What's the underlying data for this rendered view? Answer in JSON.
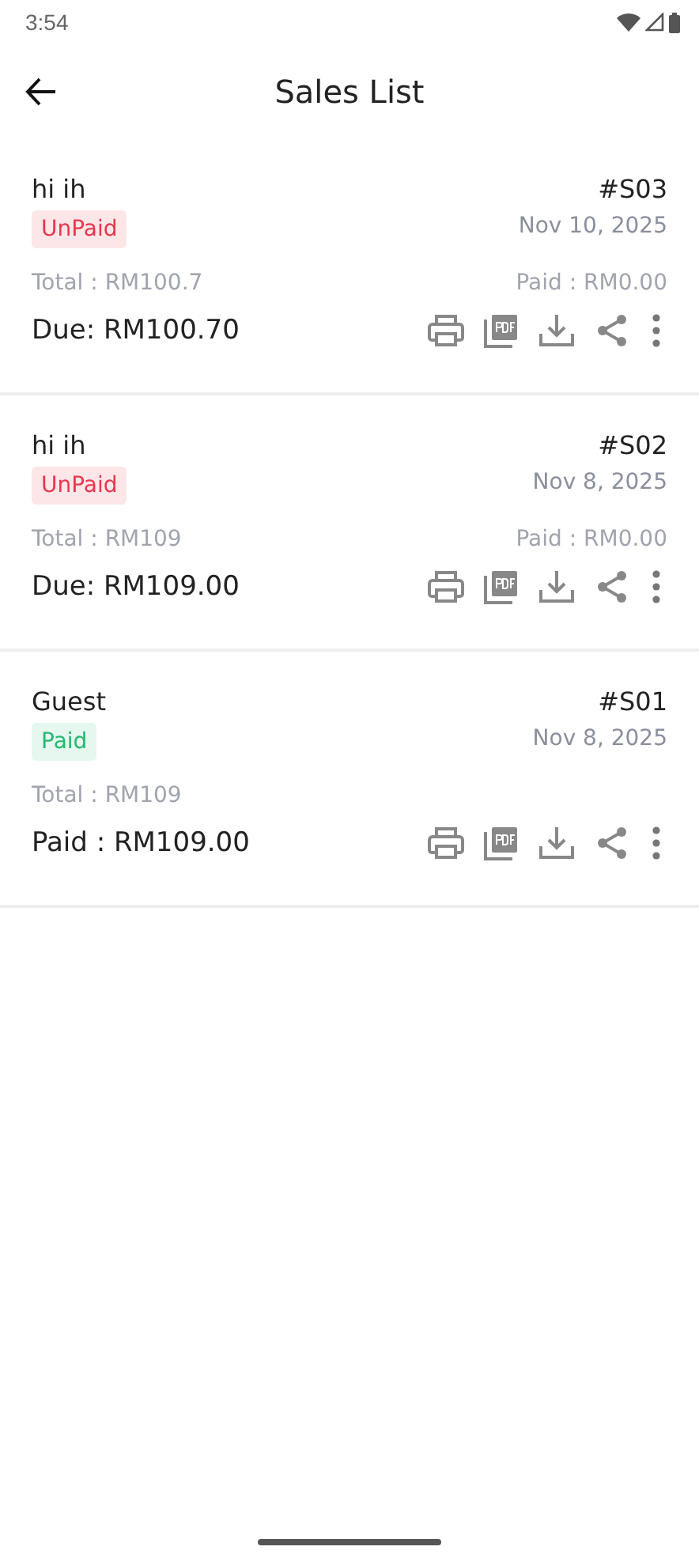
{
  "status_bar": {
    "time": "3:54"
  },
  "header": {
    "title": "Sales List"
  },
  "sales": [
    {
      "customer": "hi ih",
      "number": "#S03",
      "status": {
        "label": "UnPaid",
        "kind": "unpaid"
      },
      "date": "Nov 10, 2025",
      "total": "Total : RM100.7",
      "paid": "Paid : RM0.00",
      "balance": "Due: RM100.70"
    },
    {
      "customer": "hi ih",
      "number": "#S02",
      "status": {
        "label": "UnPaid",
        "kind": "unpaid"
      },
      "date": "Nov 8, 2025",
      "total": "Total : RM109",
      "paid": "Paid : RM0.00",
      "balance": "Due: RM109.00"
    },
    {
      "customer": "Guest",
      "number": "#S01",
      "status": {
        "label": "Paid",
        "kind": "paid"
      },
      "date": "Nov 8, 2025",
      "total": "Total : RM109",
      "balance": "Paid : RM109.00"
    }
  ]
}
